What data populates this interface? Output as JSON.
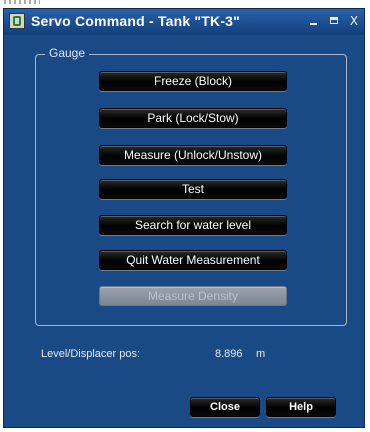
{
  "window": {
    "title": "Servo Command - Tank \"TK-3\"",
    "controls": {
      "minimize_icon": "minimize-icon",
      "maximize_icon": "maximize-icon",
      "close_label": "X"
    }
  },
  "gauge": {
    "group_label": "Gauge",
    "buttons": [
      {
        "label": "Freeze (Block)",
        "enabled": true
      },
      {
        "label": "Park (Lock/Stow)",
        "enabled": true
      },
      {
        "label": "Measure (Unlock/Unstow)",
        "enabled": true
      },
      {
        "label": "Test",
        "enabled": true
      },
      {
        "label": "Search for water level",
        "enabled": true
      },
      {
        "label": "Quit Water Measurement",
        "enabled": true
      },
      {
        "label": "Measure Density",
        "enabled": false
      }
    ]
  },
  "level": {
    "label": "Level/Displacer pos:",
    "value": "8.896",
    "unit": "m"
  },
  "footer": {
    "close_label": "Close",
    "help_label": "Help"
  },
  "colors": {
    "window_background": "#1a4a86",
    "button_background": "#000000",
    "button_text": "#ffffff",
    "disabled_button": "#8a939d"
  }
}
